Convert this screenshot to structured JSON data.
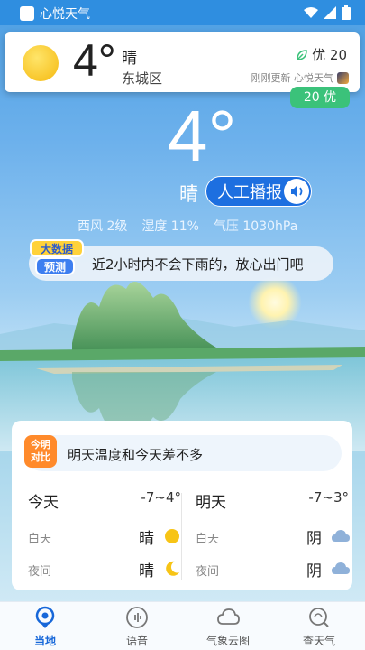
{
  "status_bar": {
    "app_name": "心悦天气"
  },
  "notification": {
    "temperature": "4°",
    "condition": "晴",
    "district": "东城区",
    "aqi_text": "优 20",
    "updated_text": "刚刚更新 心悦天气"
  },
  "aqi_badge": "20 优",
  "current": {
    "temperature": "4°",
    "condition": "晴",
    "broadcast_label": "人工播报",
    "wind": "西风 2级",
    "humidity": "湿度 11%",
    "pressure": "气压 1030hPa"
  },
  "prediction": {
    "badge_line1": "大数据",
    "badge_line2": "预测",
    "text": "近2小时内不会下雨的，放心出门吧"
  },
  "compare": {
    "badge_line1": "今明",
    "badge_line2": "对比",
    "text": "明天温度和今天差不多",
    "today": {
      "name": "今天",
      "range": "-7~4°",
      "day_label": "白天",
      "day_cond": "晴",
      "night_label": "夜间",
      "night_cond": "晴"
    },
    "tomorrow": {
      "name": "明天",
      "range": "-7~3°",
      "day_label": "白天",
      "day_cond": "阴",
      "night_label": "夜间",
      "night_cond": "阴"
    }
  },
  "nav": [
    {
      "label": "当地",
      "icon": "location-icon",
      "active": true
    },
    {
      "label": "语音",
      "icon": "voice-icon",
      "active": false
    },
    {
      "label": "气象云图",
      "icon": "cloud-icon",
      "active": false
    },
    {
      "label": "查天气",
      "icon": "search-weather-icon",
      "active": false
    }
  ],
  "colors": {
    "accent": "#1767d9",
    "aqi_green": "#3bc27a",
    "badge_orange": "#ff8a2b"
  }
}
